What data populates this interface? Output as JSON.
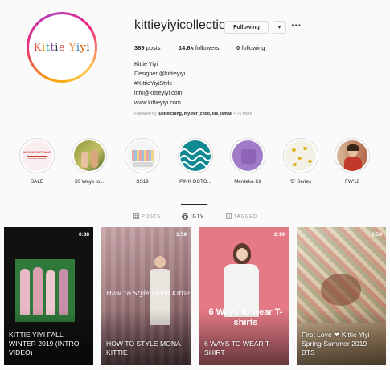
{
  "profile": {
    "username": "kittieyiyicollection",
    "follow_label": "Following",
    "dropdown_glyph": "▾",
    "more_glyph": "···",
    "logo_text": "Kittie Yiyi",
    "logo_colors": [
      "#e74c3c",
      "#f39c12",
      "#16a085",
      "#8e44ad",
      "#2c3e50",
      "#c0392b",
      "#27ae60",
      "#e67e22",
      "#2980b9",
      "#d35400",
      "#34495e"
    ],
    "stats": {
      "posts_count": "369",
      "posts_label": " posts",
      "followers_count": "14.6k",
      "followers_label": " followers",
      "following_count": "0",
      "following_label": " following"
    },
    "bio": {
      "name": "Kittie Yiyi",
      "line1": "Designer @kittieyiyi",
      "line2": "#KittieYiyiStyle",
      "line3": "info@kittieyiyi.com",
      "website": "www.kittieyiyi.com"
    },
    "followed_by_prefix": "Followed by ",
    "followed_by_names": "justretching, myster_choo, ilia_ismail",
    "followed_by_more": " + 76 more"
  },
  "highlights": [
    {
      "label": "SALE",
      "thumb_text": "MOVING OUT SALE"
    },
    {
      "label": "50 Ways to..."
    },
    {
      "label": "SS19"
    },
    {
      "label": "PINK OCTO..."
    },
    {
      "label": "Merdeka Kit"
    },
    {
      "label": "'B' Series"
    },
    {
      "label": "FW'18"
    }
  ],
  "tabs": [
    {
      "label": "POSTS",
      "icon": "grid-icon"
    },
    {
      "label": "IGTV",
      "icon": "igtv-icon"
    },
    {
      "label": "TAGGED",
      "icon": "tag-icon"
    }
  ],
  "videos": [
    {
      "duration": "0:38",
      "caption": "KITTIE YIYI FALL WINTER 2019 (INTRO VIDEO)"
    },
    {
      "duration": "1:59",
      "caption": "HOW TO STYLE MONA KITTIE",
      "overlay": "How To Style Mona Kittie"
    },
    {
      "duration": "2:19",
      "caption": "6 WAYS TO WEAR T-SHIRT",
      "overlay": "6 Ways to wear T-shirts"
    },
    {
      "duration": "2:54",
      "caption": "First Love ❤ Kittie Yiyi Spring Summer 2019 BTS"
    }
  ],
  "colors": {
    "link": "#003569",
    "muted": "#8e8e8e",
    "border": "#dbdbdb"
  }
}
